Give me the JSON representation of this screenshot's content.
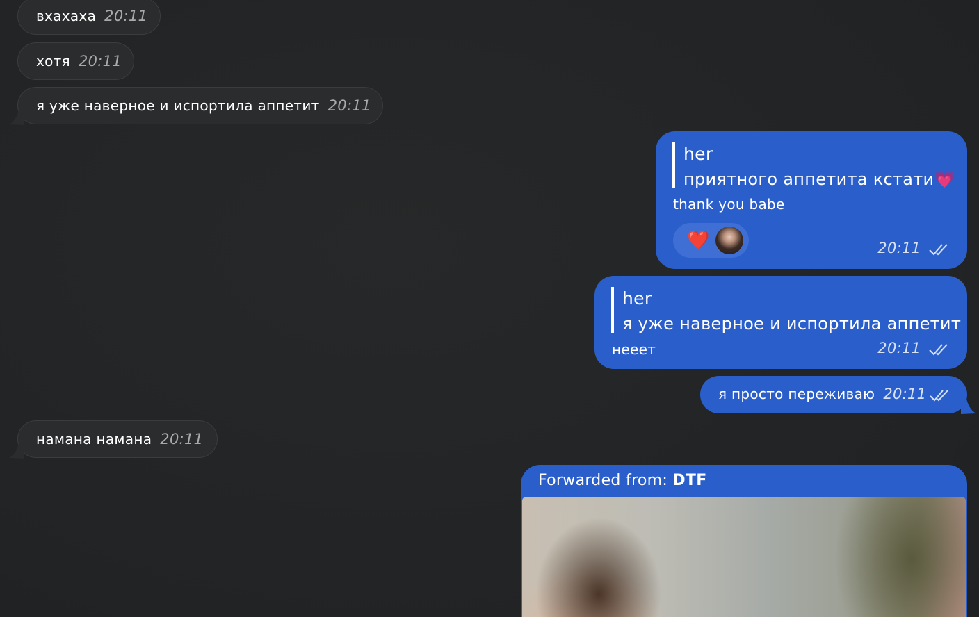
{
  "incoming": [
    {
      "text": "вхахаха",
      "time": "20:11"
    },
    {
      "text": "хотя",
      "time": "20:11"
    },
    {
      "text": "я уже наверное и испортила аппетит",
      "time": "20:11"
    },
    {
      "text": "намана намана",
      "time": "20:11"
    }
  ],
  "outgoing": [
    {
      "quote_name": "her",
      "quote_text": "приятного аппетита кстати💗",
      "text": "thank you babe",
      "reaction": "❤️",
      "time": "20:11",
      "status_icon": "double-check-icon"
    },
    {
      "quote_name": "her",
      "quote_text": "я уже наверное и испортила аппетит",
      "text": "нееет",
      "time": "20:11",
      "status_icon": "double-check-icon"
    },
    {
      "text": "я просто переживаю",
      "time": "20:11",
      "status_icon": "double-check-icon"
    }
  ],
  "forwarded": {
    "prefix": "Forwarded from: ",
    "source": "DTF"
  },
  "colors": {
    "background": "#222426",
    "incoming_bubble": "#2a2c2e",
    "outgoing_bubble": "#2a5fcb"
  }
}
